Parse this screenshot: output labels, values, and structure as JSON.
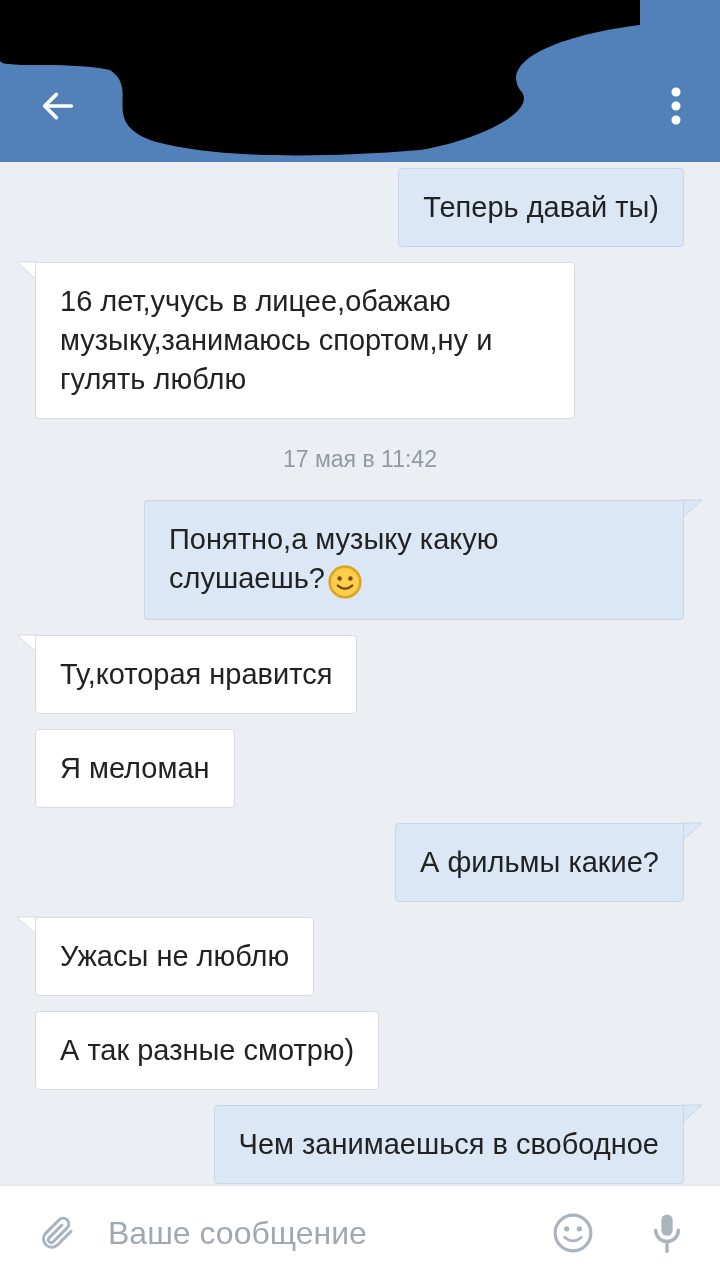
{
  "header": {
    "redacted": true
  },
  "messages": [
    {
      "kind": "outgoing",
      "tail": false,
      "text": "Теперь давай ты)"
    },
    {
      "kind": "incoming",
      "tail": true,
      "text": "16 лет,учусь в лицее,обажаю музыку,занимаюсь спортом,ну и гулять люблю"
    },
    {
      "kind": "date",
      "text": "17 мая в 11:42"
    },
    {
      "kind": "outgoing",
      "tail": true,
      "text": "Понятно,а музыку какую слушаешь?",
      "emoji": true
    },
    {
      "kind": "incoming",
      "tail": true,
      "text": "Ту,которая нравится"
    },
    {
      "kind": "incoming",
      "tail": false,
      "text": "Я меломан"
    },
    {
      "kind": "outgoing",
      "tail": true,
      "text": "А фильмы какие?"
    },
    {
      "kind": "incoming",
      "tail": true,
      "text": "Ужасы не люблю"
    },
    {
      "kind": "incoming",
      "tail": false,
      "text": "А так разные смотрю)"
    },
    {
      "kind": "outgoing",
      "tail": true,
      "text": "Чем занимаешься в свободное"
    }
  ],
  "composer": {
    "placeholder": "Ваше сообщение"
  }
}
